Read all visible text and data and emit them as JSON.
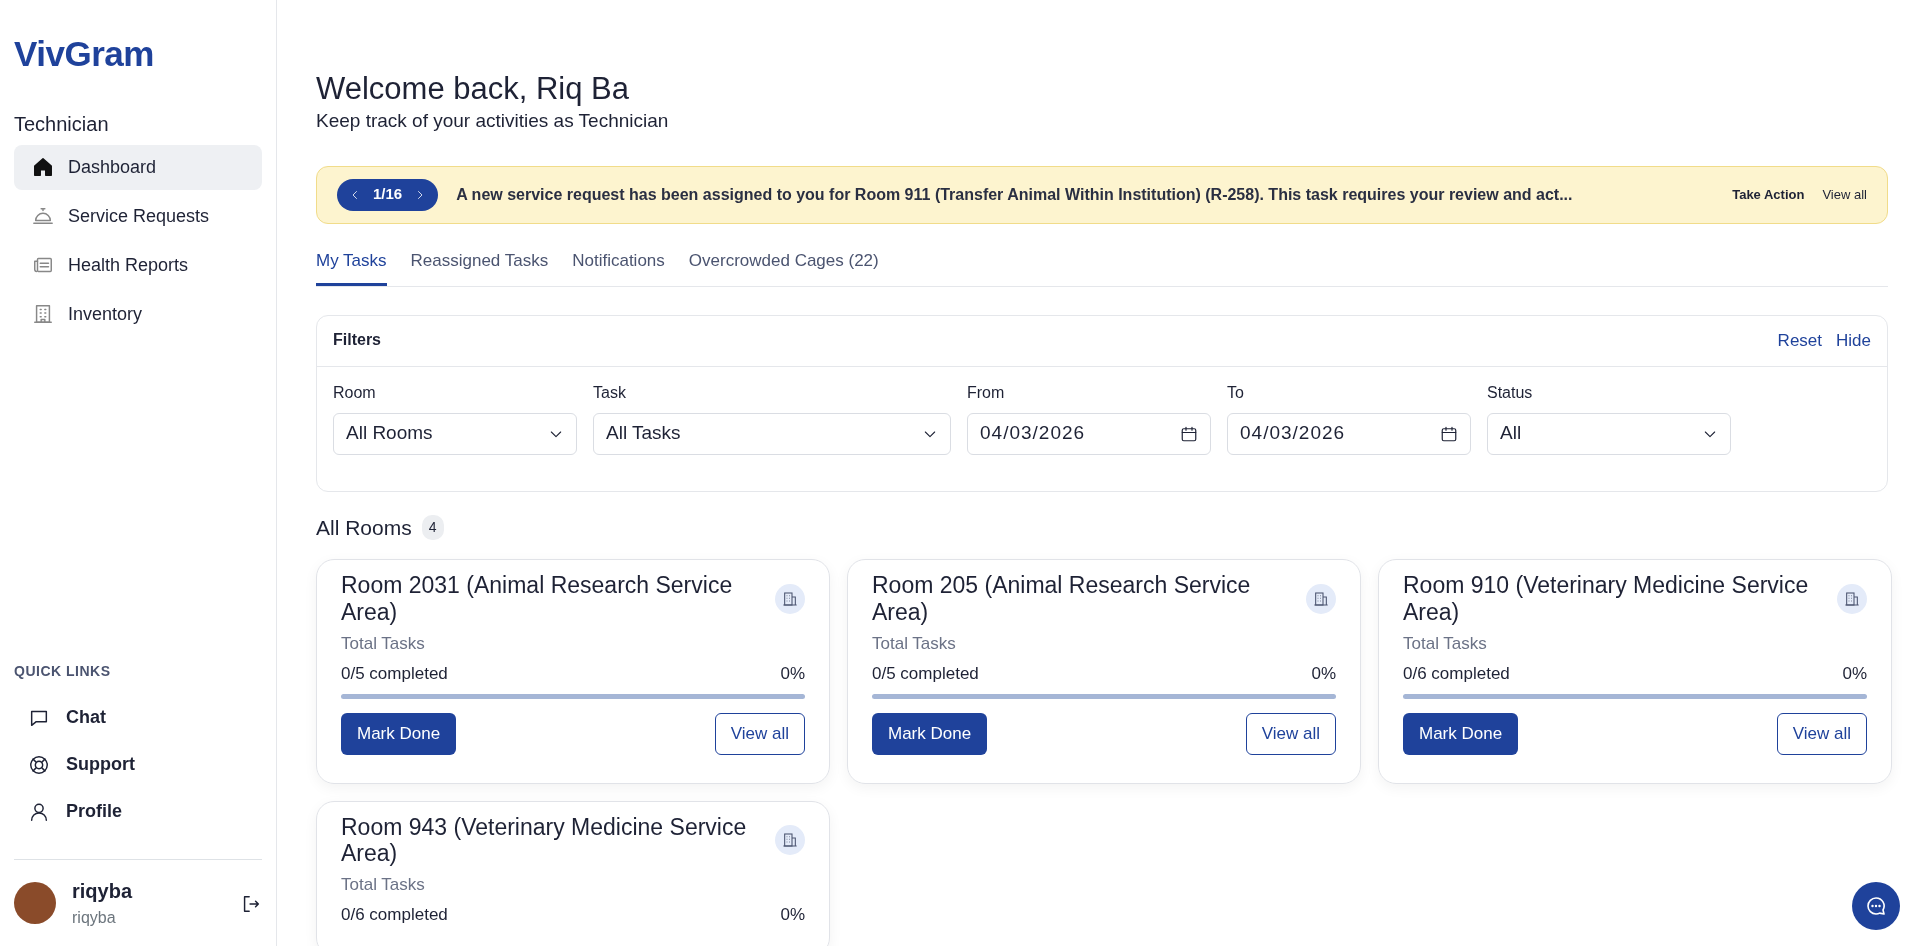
{
  "sidebar": {
    "logo": "VivGram",
    "role": "Technician",
    "nav": [
      {
        "label": "Dashboard",
        "selected": true
      },
      {
        "label": "Service Requests",
        "selected": false
      },
      {
        "label": "Health Reports",
        "selected": false
      },
      {
        "label": "Inventory",
        "selected": false
      }
    ],
    "quick_links_title": "QUICK LINKS",
    "quick_links": [
      {
        "label": "Chat"
      },
      {
        "label": "Support"
      },
      {
        "label": "Profile"
      }
    ],
    "user": {
      "name": "riqyba",
      "handle": "riqyba"
    }
  },
  "header": {
    "title": "Welcome back, Riq Ba",
    "subtitle": "Keep track of your activities as Technician"
  },
  "banner": {
    "counter": "1/16",
    "message": "A new service request has been assigned to you for Room 911 (Transfer Animal Within Institution) (R-258). This task requires your review and act...",
    "action": "Take Action",
    "view_all": "View all"
  },
  "tabs": [
    {
      "label": "My Tasks",
      "selected": true
    },
    {
      "label": "Reassigned Tasks",
      "selected": false
    },
    {
      "label": "Notifications",
      "selected": false
    },
    {
      "label": "Overcrowded Cages (22)",
      "selected": false
    }
  ],
  "filters": {
    "title": "Filters",
    "reset": "Reset",
    "hide": "Hide",
    "fields": [
      {
        "kind": "select",
        "label": "Room",
        "value": "All Rooms",
        "wide": false
      },
      {
        "kind": "select",
        "label": "Task",
        "value": "All Tasks",
        "wide": true
      },
      {
        "kind": "date",
        "label": "From",
        "value": "04/03/2026",
        "wide": false
      },
      {
        "kind": "date",
        "label": "To",
        "value": "04/03/2026",
        "wide": false
      },
      {
        "kind": "select",
        "label": "Status",
        "value": "All",
        "wide": false
      }
    ]
  },
  "rooms": {
    "title": "All Rooms",
    "count": "4",
    "cards": [
      {
        "title": "Room 2031 (Animal Research Service Area)",
        "total_label": "Total Tasks",
        "completed": "0/5 completed",
        "percent": "0%",
        "level": 0,
        "mark_done": "Mark Done",
        "view_all": "View all"
      },
      {
        "title": "Room 205 (Animal Research Service Area)",
        "total_label": "Total Tasks",
        "completed": "0/5 completed",
        "percent": "0%",
        "level": 0,
        "mark_done": "Mark Done",
        "view_all": "View all"
      },
      {
        "title": "Room 910 (Veterinary Medicine Service Area)",
        "total_label": "Total Tasks",
        "completed": "0/6 completed",
        "percent": "0%",
        "level": 0,
        "mark_done": "Mark Done",
        "view_all": "View all"
      },
      {
        "title": "Room 943 (Veterinary Medicine Service Area)",
        "total_label": "Total Tasks",
        "completed": "0/6 completed",
        "percent": "0%"
      }
    ]
  }
}
